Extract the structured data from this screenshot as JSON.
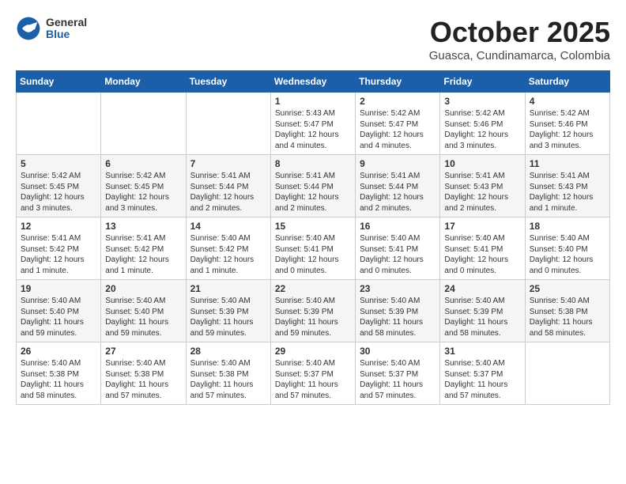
{
  "logo": {
    "general": "General",
    "blue": "Blue"
  },
  "title": "October 2025",
  "location": "Guasca, Cundinamarca, Colombia",
  "days_of_week": [
    "Sunday",
    "Monday",
    "Tuesday",
    "Wednesday",
    "Thursday",
    "Friday",
    "Saturday"
  ],
  "weeks": [
    [
      {
        "day": "",
        "info": ""
      },
      {
        "day": "",
        "info": ""
      },
      {
        "day": "",
        "info": ""
      },
      {
        "day": "1",
        "info": "Sunrise: 5:43 AM\nSunset: 5:47 PM\nDaylight: 12 hours\nand 4 minutes."
      },
      {
        "day": "2",
        "info": "Sunrise: 5:42 AM\nSunset: 5:47 PM\nDaylight: 12 hours\nand 4 minutes."
      },
      {
        "day": "3",
        "info": "Sunrise: 5:42 AM\nSunset: 5:46 PM\nDaylight: 12 hours\nand 3 minutes."
      },
      {
        "day": "4",
        "info": "Sunrise: 5:42 AM\nSunset: 5:46 PM\nDaylight: 12 hours\nand 3 minutes."
      }
    ],
    [
      {
        "day": "5",
        "info": "Sunrise: 5:42 AM\nSunset: 5:45 PM\nDaylight: 12 hours\nand 3 minutes."
      },
      {
        "day": "6",
        "info": "Sunrise: 5:42 AM\nSunset: 5:45 PM\nDaylight: 12 hours\nand 3 minutes."
      },
      {
        "day": "7",
        "info": "Sunrise: 5:41 AM\nSunset: 5:44 PM\nDaylight: 12 hours\nand 2 minutes."
      },
      {
        "day": "8",
        "info": "Sunrise: 5:41 AM\nSunset: 5:44 PM\nDaylight: 12 hours\nand 2 minutes."
      },
      {
        "day": "9",
        "info": "Sunrise: 5:41 AM\nSunset: 5:44 PM\nDaylight: 12 hours\nand 2 minutes."
      },
      {
        "day": "10",
        "info": "Sunrise: 5:41 AM\nSunset: 5:43 PM\nDaylight: 12 hours\nand 2 minutes."
      },
      {
        "day": "11",
        "info": "Sunrise: 5:41 AM\nSunset: 5:43 PM\nDaylight: 12 hours\nand 1 minute."
      }
    ],
    [
      {
        "day": "12",
        "info": "Sunrise: 5:41 AM\nSunset: 5:42 PM\nDaylight: 12 hours\nand 1 minute."
      },
      {
        "day": "13",
        "info": "Sunrise: 5:41 AM\nSunset: 5:42 PM\nDaylight: 12 hours\nand 1 minute."
      },
      {
        "day": "14",
        "info": "Sunrise: 5:40 AM\nSunset: 5:42 PM\nDaylight: 12 hours\nand 1 minute."
      },
      {
        "day": "15",
        "info": "Sunrise: 5:40 AM\nSunset: 5:41 PM\nDaylight: 12 hours\nand 0 minutes."
      },
      {
        "day": "16",
        "info": "Sunrise: 5:40 AM\nSunset: 5:41 PM\nDaylight: 12 hours\nand 0 minutes."
      },
      {
        "day": "17",
        "info": "Sunrise: 5:40 AM\nSunset: 5:41 PM\nDaylight: 12 hours\nand 0 minutes."
      },
      {
        "day": "18",
        "info": "Sunrise: 5:40 AM\nSunset: 5:40 PM\nDaylight: 12 hours\nand 0 minutes."
      }
    ],
    [
      {
        "day": "19",
        "info": "Sunrise: 5:40 AM\nSunset: 5:40 PM\nDaylight: 11 hours\nand 59 minutes."
      },
      {
        "day": "20",
        "info": "Sunrise: 5:40 AM\nSunset: 5:40 PM\nDaylight: 11 hours\nand 59 minutes."
      },
      {
        "day": "21",
        "info": "Sunrise: 5:40 AM\nSunset: 5:39 PM\nDaylight: 11 hours\nand 59 minutes."
      },
      {
        "day": "22",
        "info": "Sunrise: 5:40 AM\nSunset: 5:39 PM\nDaylight: 11 hours\nand 59 minutes."
      },
      {
        "day": "23",
        "info": "Sunrise: 5:40 AM\nSunset: 5:39 PM\nDaylight: 11 hours\nand 58 minutes."
      },
      {
        "day": "24",
        "info": "Sunrise: 5:40 AM\nSunset: 5:39 PM\nDaylight: 11 hours\nand 58 minutes."
      },
      {
        "day": "25",
        "info": "Sunrise: 5:40 AM\nSunset: 5:38 PM\nDaylight: 11 hours\nand 58 minutes."
      }
    ],
    [
      {
        "day": "26",
        "info": "Sunrise: 5:40 AM\nSunset: 5:38 PM\nDaylight: 11 hours\nand 58 minutes."
      },
      {
        "day": "27",
        "info": "Sunrise: 5:40 AM\nSunset: 5:38 PM\nDaylight: 11 hours\nand 57 minutes."
      },
      {
        "day": "28",
        "info": "Sunrise: 5:40 AM\nSunset: 5:38 PM\nDaylight: 11 hours\nand 57 minutes."
      },
      {
        "day": "29",
        "info": "Sunrise: 5:40 AM\nSunset: 5:37 PM\nDaylight: 11 hours\nand 57 minutes."
      },
      {
        "day": "30",
        "info": "Sunrise: 5:40 AM\nSunset: 5:37 PM\nDaylight: 11 hours\nand 57 minutes."
      },
      {
        "day": "31",
        "info": "Sunrise: 5:40 AM\nSunset: 5:37 PM\nDaylight: 11 hours\nand 57 minutes."
      },
      {
        "day": "",
        "info": ""
      }
    ]
  ]
}
